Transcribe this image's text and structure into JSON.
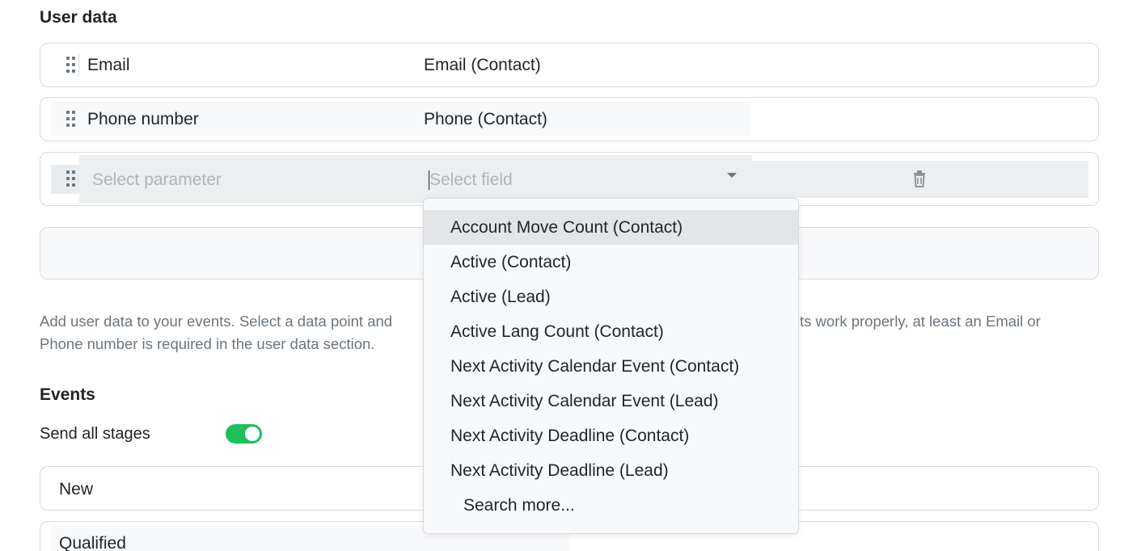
{
  "user_data": {
    "title": "User data",
    "rows": [
      {
        "parameter": "Email",
        "field": "Email (Contact)"
      },
      {
        "parameter": "Phone number",
        "field": "Phone (Contact)"
      }
    ],
    "new_row": {
      "parameter_placeholder": "Select parameter",
      "field_placeholder": "Select field"
    },
    "help_left": "Add user data to your events. Select a data point and",
    "help_right": "ts work properly, at least an Email or",
    "help_line2": "Phone number is required in the user data section."
  },
  "dropdown": {
    "options": [
      "Account Move Count (Contact)",
      "Active (Contact)",
      "Active (Lead)",
      "Active Lang Count (Contact)",
      "Next Activity Calendar Event (Contact)",
      "Next Activity Calendar Event (Lead)",
      "Next Activity Deadline (Contact)",
      "Next Activity Deadline (Lead)"
    ],
    "search_more": "Search more..."
  },
  "events": {
    "title": "Events",
    "send_all_label": "Send all stages",
    "send_all_enabled": true,
    "stages": [
      "New",
      "Qualified"
    ]
  },
  "icons": {
    "drag": "drag-handle-icon",
    "delete": "trash-icon",
    "caret": "caret-down-icon"
  },
  "colors": {
    "toggle_on": "#1fbf5c",
    "placeholder": "#adb5bd",
    "border": "#d8dadd"
  }
}
